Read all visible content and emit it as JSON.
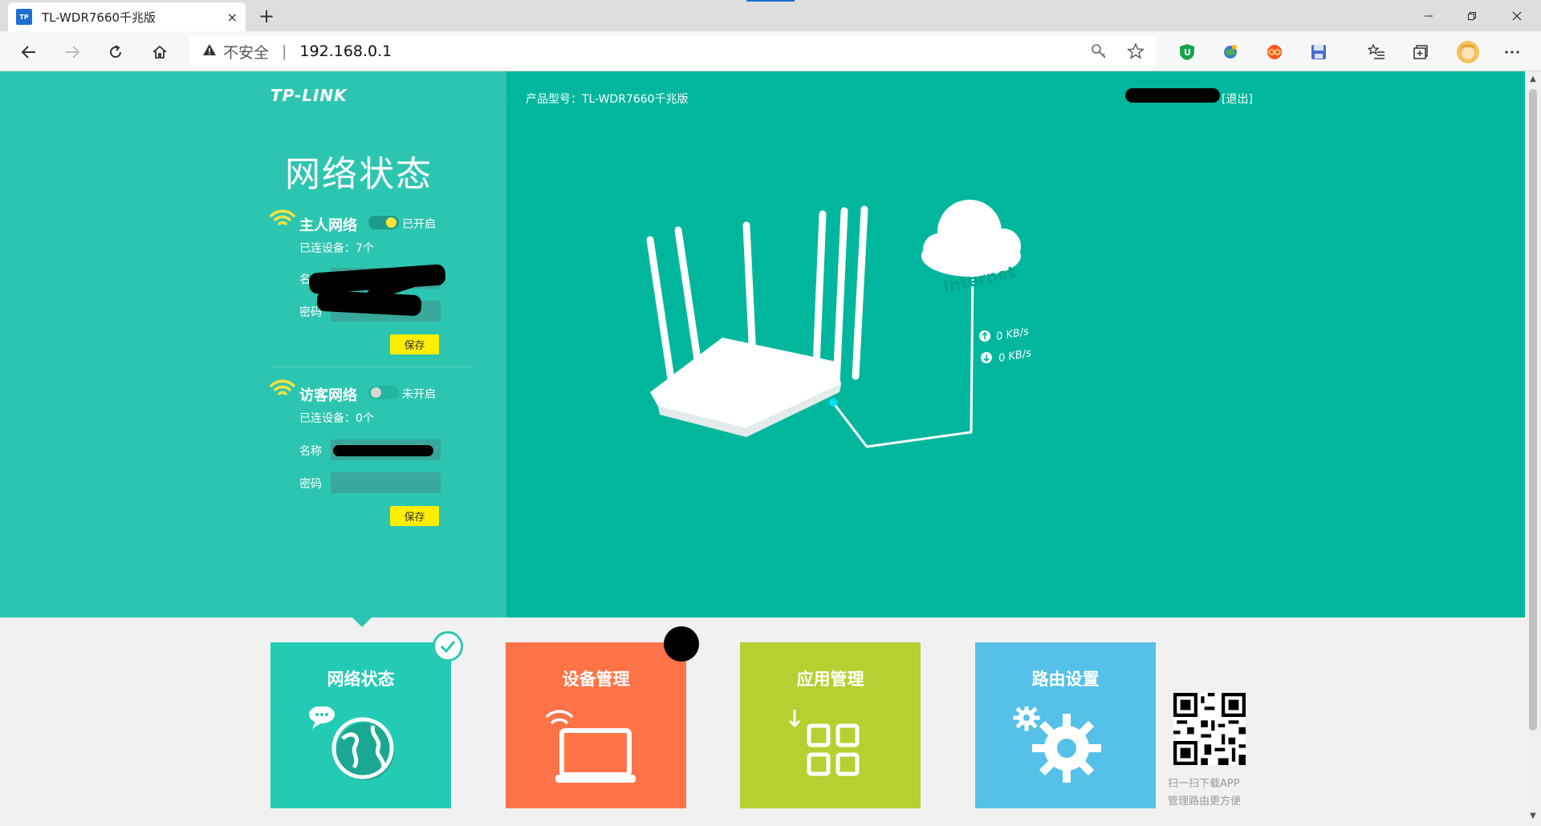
{
  "browser": {
    "tab_title": "TL-WDR7660千兆版",
    "tab_favicon": "TP",
    "tab_close": "×",
    "new_tab": "+",
    "address": {
      "security_label": "不安全",
      "separator": "|",
      "url": "192.168.0.1"
    }
  },
  "header": {
    "logo": "TP-LINK",
    "model_label": "产品型号：TL-WDR7660千兆版",
    "logout": "[退出]"
  },
  "panel": {
    "title": "网络状态",
    "main_network": {
      "name": "主人网络",
      "state": "已开启",
      "connected": "已连设备：7个",
      "name_label": "名称",
      "password_label": "密码",
      "save": "保存"
    },
    "guest_network": {
      "name": "访客网络",
      "state": "未开启",
      "connected": "已连设备：0个",
      "name_label": "名称",
      "password_label": "密码",
      "save": "保存"
    }
  },
  "diagram": {
    "cloud_label": "Internet",
    "upload": "0 KB/s",
    "download": "0 KB/s"
  },
  "tiles": [
    {
      "label": "网络状态",
      "color": "#24cbb4"
    },
    {
      "label": "设备管理",
      "color": "#ff7348"
    },
    {
      "label": "应用管理",
      "color": "#b7cf31"
    },
    {
      "label": "路由设置",
      "color": "#56c1e8"
    }
  ],
  "app_promo": {
    "line1": "扫一扫下载APP",
    "line2": "管理路由更方便"
  },
  "colors": {
    "top_bg": "#00b79d",
    "left_panel_bg": "#2cc6b0",
    "save_button": "#ffee00",
    "wifi_icon": "#ffe23a"
  }
}
